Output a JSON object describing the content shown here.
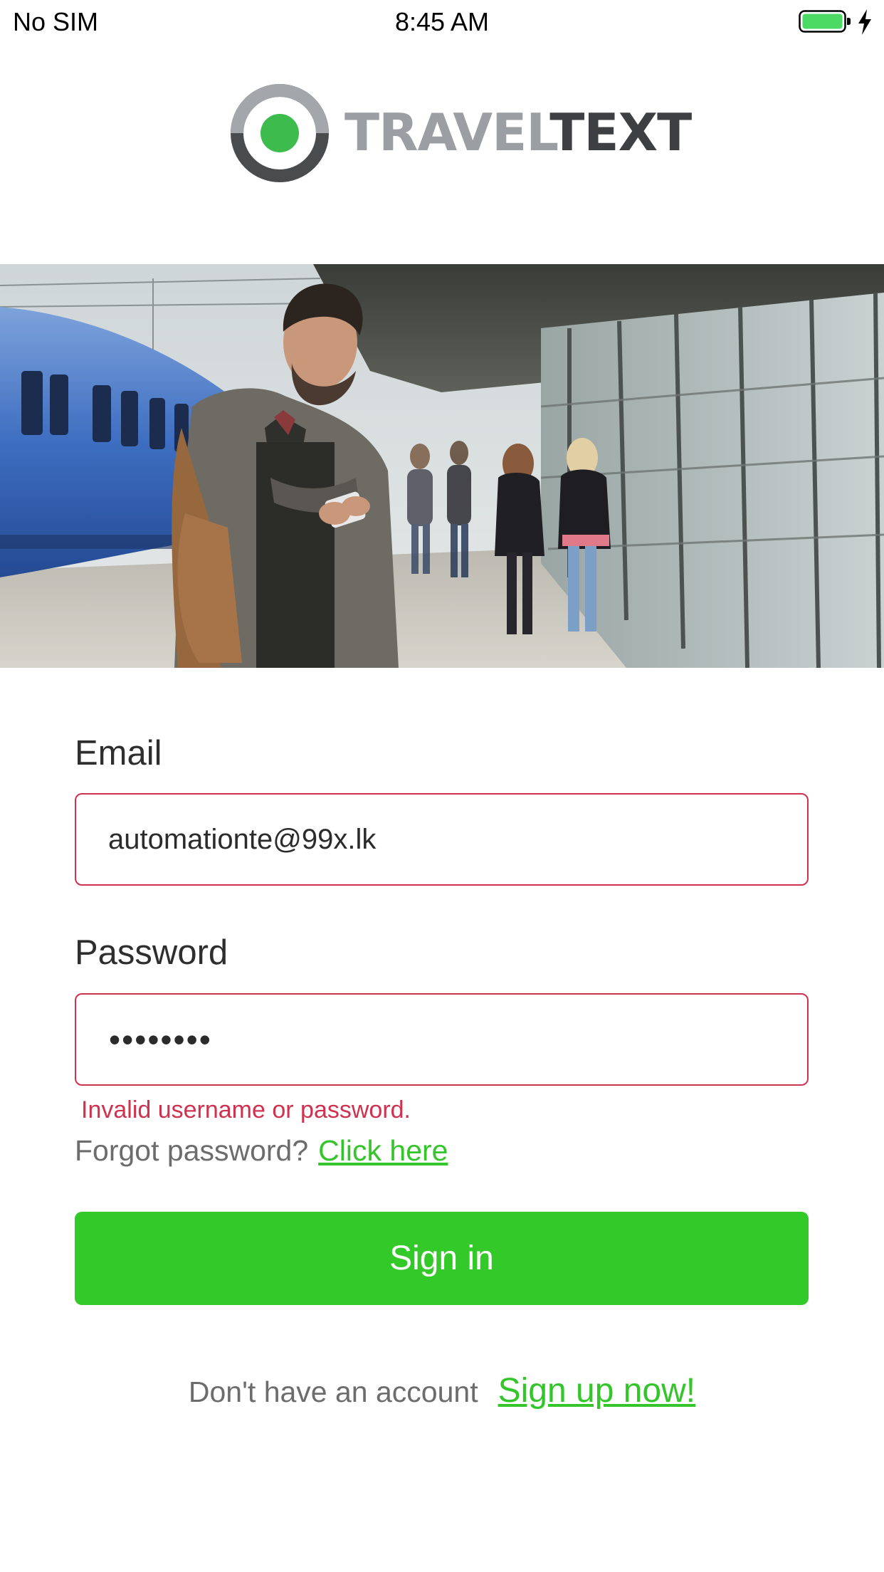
{
  "status_bar": {
    "carrier": "No SIM",
    "time": "8:45 AM",
    "battery_icon": "battery-full-icon",
    "charging_icon": "charging-bolt-icon",
    "battery_color": "#4cd964"
  },
  "logo": {
    "text_light": "TRAVEL",
    "text_dark": "TEXT",
    "icon": "traveltext-logo-icon",
    "accent_color": "#3dbb4c"
  },
  "hero": {
    "icon": "hero-photo-train-platform"
  },
  "form": {
    "email_label": "Email",
    "email_value": "automationte@99x.lk",
    "password_label": "Password",
    "password_value": "••••••••",
    "error": "Invalid username or password.",
    "forgot_label": "Forgot password?",
    "forgot_link": "Click here",
    "signin_label": "Sign in",
    "signup_label": "Don't have an account",
    "signup_link": "Sign up now!"
  },
  "colors": {
    "accent_green": "#33c928",
    "error_red": "#d0314f"
  }
}
